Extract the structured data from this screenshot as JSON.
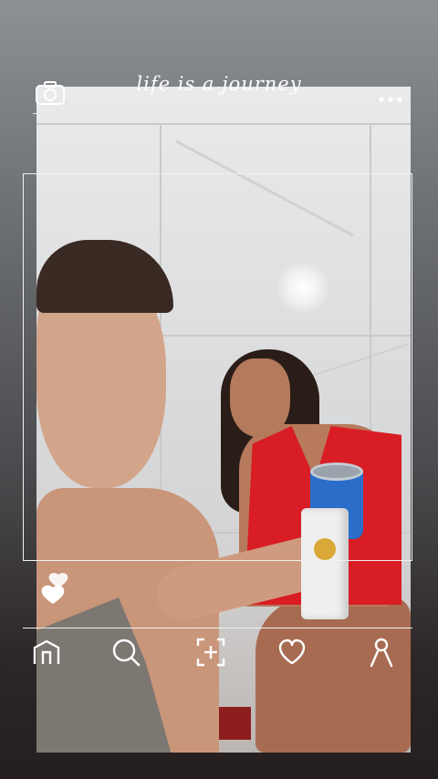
{
  "header": {
    "title": "life is a journey",
    "camera_icon": "camera-icon",
    "more_icon": "more-dots-icon"
  },
  "overlay": {
    "like_icon": "hearts-icon"
  },
  "bottom_nav": [
    {
      "icon": "home-icon"
    },
    {
      "icon": "search-icon"
    },
    {
      "icon": "add-post-icon"
    },
    {
      "icon": "heart-icon"
    },
    {
      "icon": "profile-icon"
    }
  ],
  "colors": {
    "overlay_line": "#f1f1f1",
    "dress": "#d81d25",
    "tumbler": "#2a6ec9"
  }
}
